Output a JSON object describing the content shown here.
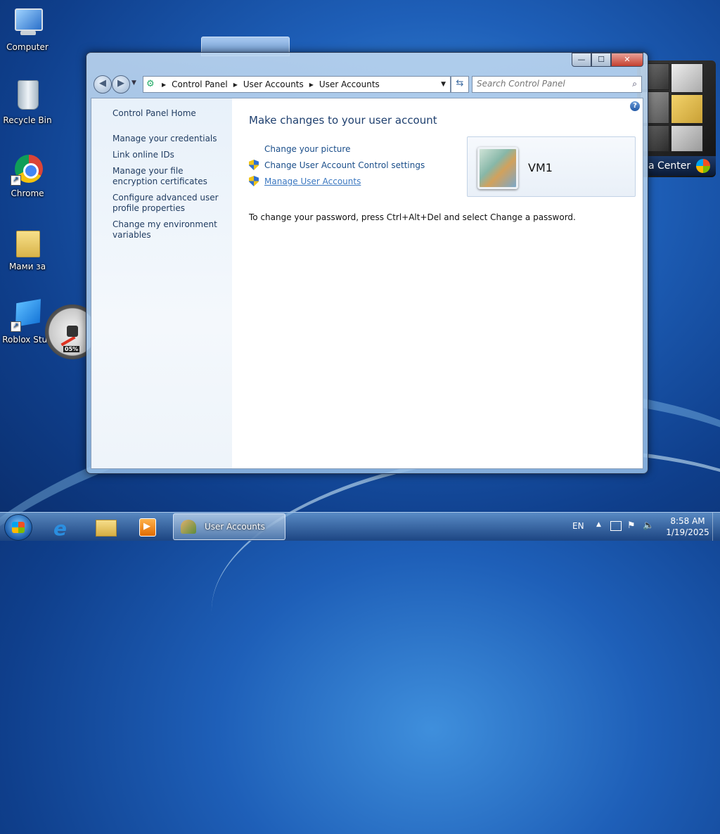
{
  "desktop": {
    "icons": [
      {
        "label": "Computer",
        "icon": "computer-icon"
      },
      {
        "label": "Recycle Bin",
        "icon": "recycle-bin-icon"
      },
      {
        "label": "Chrome",
        "icon": "chrome-icon"
      },
      {
        "label": "Мами за",
        "icon": "folder-icon"
      },
      {
        "label": "Roblox Stud",
        "icon": "roblox-studio-icon"
      }
    ],
    "cpu_gadget": {
      "value": "05%"
    },
    "media_center_gadget": {
      "label": "a Center"
    }
  },
  "window": {
    "title": "User Accounts",
    "caption_buttons": {
      "minimize": "—",
      "maximize": "☐",
      "close": "✕"
    },
    "address": {
      "crumbs": [
        "Control Panel",
        "User Accounts",
        "User Accounts"
      ]
    },
    "search": {
      "placeholder": "Search Control Panel"
    },
    "left_pane": {
      "home": "Control Panel Home",
      "links": [
        "Manage your credentials",
        "Link online IDs",
        "Manage your file encryption certificates",
        "Configure advanced user profile properties",
        "Change my environment variables"
      ]
    },
    "main": {
      "heading": "Make changes to your user account",
      "tasks": [
        {
          "label": "Change your picture",
          "shield": false
        },
        {
          "label": "Change User Account Control settings",
          "shield": true
        },
        {
          "label": "Manage User Accounts",
          "shield": true
        }
      ],
      "password_note": "To change your password, press Ctrl+Alt+Del and select Change a password.",
      "user": {
        "name": "VM1"
      }
    }
  },
  "taskbar": {
    "active_task": "User Accounts",
    "language": "EN",
    "time": "8:58 AM",
    "date": "1/19/2025"
  }
}
